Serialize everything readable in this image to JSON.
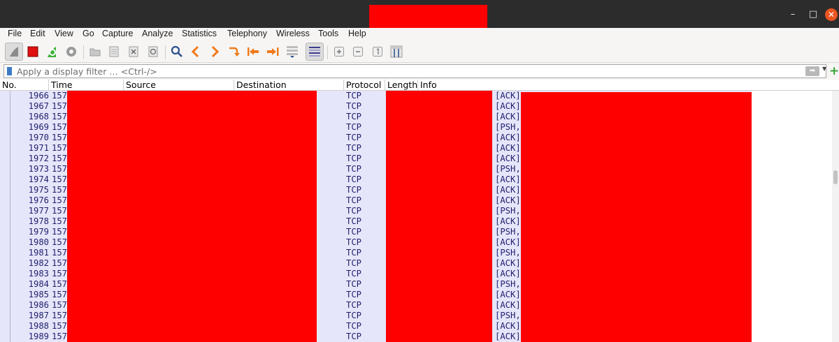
{
  "menubar": {
    "items": [
      "File",
      "Edit",
      "View",
      "Go",
      "Capture",
      "Analyze",
      "Statistics",
      "Telephony",
      "Wireless",
      "Tools",
      "Help"
    ]
  },
  "toolbar": {
    "icons": [
      "shark-fin-icon",
      "stop-capture-icon",
      "restart-capture-icon",
      "capture-options-icon",
      "open-file-icon",
      "save-file-icon",
      "close-file-icon",
      "reload-file-icon",
      "find-packet-icon",
      "go-back-icon",
      "go-forward-icon",
      "go-to-packet-icon",
      "first-packet-icon",
      "last-packet-icon",
      "auto-scroll-icon",
      "colorize-icon",
      "zoom-in-icon",
      "zoom-out-icon",
      "normal-size-icon",
      "resize-columns-icon"
    ]
  },
  "filter": {
    "placeholder": "Apply a display filter … <Ctrl-/>"
  },
  "columns": [
    "No.",
    "Time",
    "Source",
    "Destination",
    "Protocol",
    "Length",
    "Info"
  ],
  "packets": [
    {
      "no": "1966",
      "time": "157",
      "protocol": "TCP",
      "info": "[ACK]"
    },
    {
      "no": "1967",
      "time": "157",
      "protocol": "TCP",
      "info": "[ACK]"
    },
    {
      "no": "1968",
      "time": "157",
      "protocol": "TCP",
      "info": "[ACK]"
    },
    {
      "no": "1969",
      "time": "157",
      "protocol": "TCP",
      "info": "[PSH,"
    },
    {
      "no": "1970",
      "time": "157",
      "protocol": "TCP",
      "info": "[ACK]"
    },
    {
      "no": "1971",
      "time": "157",
      "protocol": "TCP",
      "info": "[ACK]"
    },
    {
      "no": "1972",
      "time": "157",
      "protocol": "TCP",
      "info": "[ACK]"
    },
    {
      "no": "1973",
      "time": "157",
      "protocol": "TCP",
      "info": "[PSH,"
    },
    {
      "no": "1974",
      "time": "157",
      "protocol": "TCP",
      "info": "[ACK]"
    },
    {
      "no": "1975",
      "time": "157",
      "protocol": "TCP",
      "info": "[ACK]"
    },
    {
      "no": "1976",
      "time": "157",
      "protocol": "TCP",
      "info": "[ACK]"
    },
    {
      "no": "1977",
      "time": "157",
      "protocol": "TCP",
      "info": "[PSH,"
    },
    {
      "no": "1978",
      "time": "157",
      "protocol": "TCP",
      "info": "[ACK]"
    },
    {
      "no": "1979",
      "time": "157",
      "protocol": "TCP",
      "info": "[PSH,"
    },
    {
      "no": "1980",
      "time": "157",
      "protocol": "TCP",
      "info": "[ACK]"
    },
    {
      "no": "1981",
      "time": "157",
      "protocol": "TCP",
      "info": "[PSH,"
    },
    {
      "no": "1982",
      "time": "157",
      "protocol": "TCP",
      "info": "[ACK]"
    },
    {
      "no": "1983",
      "time": "157",
      "protocol": "TCP",
      "info": "[ACK]"
    },
    {
      "no": "1984",
      "time": "157",
      "protocol": "TCP",
      "info": "[PSH,"
    },
    {
      "no": "1985",
      "time": "157",
      "protocol": "TCP",
      "info": "[ACK]"
    },
    {
      "no": "1986",
      "time": "157",
      "protocol": "TCP",
      "info": "[ACK]"
    },
    {
      "no": "1987",
      "time": "157",
      "protocol": "TCP",
      "info": "[PSH,"
    },
    {
      "no": "1988",
      "time": "157",
      "protocol": "TCP",
      "info": "[ACK]"
    },
    {
      "no": "1989",
      "time": "157",
      "protocol": "TCP",
      "info": "[ACK]"
    }
  ],
  "colors": {
    "row_bg": "#e6e6fa",
    "row_text": "#1f1f6d",
    "redaction": "#ff0000",
    "titlebar": "#2c2c2c",
    "close_button": "#e9541f"
  }
}
